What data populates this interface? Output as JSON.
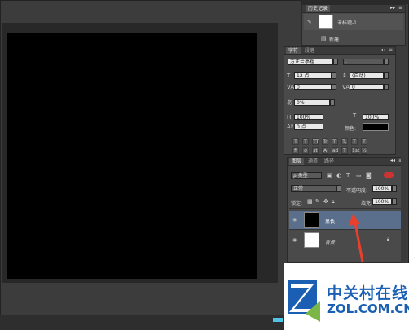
{
  "history": {
    "tab_label": "历史记录",
    "doc_name": "未标题-1",
    "item_label": "新建"
  },
  "character": {
    "tab_active": "字符",
    "tab_other": "段落",
    "font_family": "方正兰亭粗...",
    "font_style": "-",
    "font_size": "12 点",
    "leading": "(自动)",
    "kerning": "0",
    "tracking": "0",
    "scale_small": "0%",
    "vertical_scale": "100%",
    "horizontal_scale": "100%",
    "baseline": "0 点",
    "color_label": "颜色:",
    "type_buttons": [
      "T",
      "T",
      "TT",
      "Tr",
      "T'",
      "T,",
      "T",
      "T"
    ],
    "extra_buttons": [
      "fi",
      "σ",
      "st",
      "A",
      "ad",
      "T",
      "1st",
      "½"
    ]
  },
  "layers": {
    "tabs": [
      "图层",
      "通道",
      "路径"
    ],
    "filter_label": "ρ 类型",
    "blend_mode": "正常",
    "opacity_label": "不透明度:",
    "opacity_value": "100%",
    "lock_label": "锁定:",
    "fill_label": "填充:",
    "fill_value": "100%",
    "items": [
      {
        "name": "黑色",
        "thumb_color": "#000000"
      },
      {
        "name": "背景",
        "thumb_color": "#ffffff"
      }
    ]
  },
  "watermark": {
    "cn_text": "中关村在线",
    "en_text": "ZOL.COM.CN"
  },
  "colors": {
    "arrow": "#e8402c",
    "selected_layer": "#5a6f8c",
    "logo_blue": "#1a5fb4",
    "logo_green": "#7ab648"
  }
}
